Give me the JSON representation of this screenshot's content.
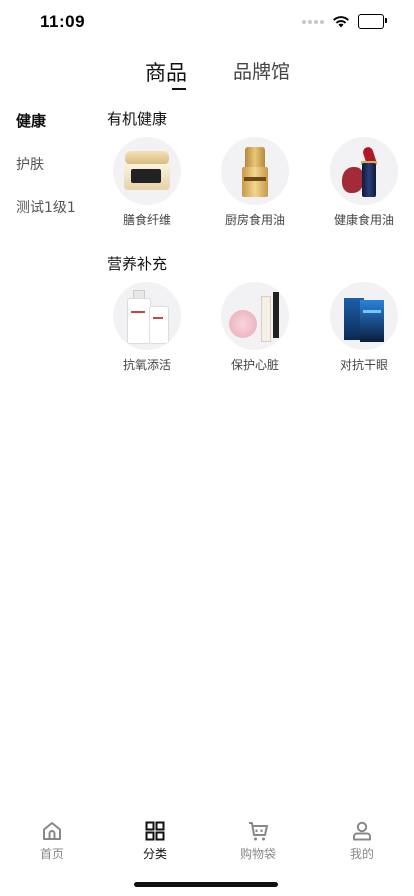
{
  "status_bar": {
    "time": "11:09"
  },
  "header": {
    "tabs": [
      {
        "label": "商品",
        "active": true
      },
      {
        "label": "品牌馆",
        "active": false
      }
    ]
  },
  "sidebar": {
    "items": [
      {
        "label": "健康",
        "active": true
      },
      {
        "label": "护肤",
        "active": false
      },
      {
        "label": "测试1级1",
        "active": false
      }
    ]
  },
  "sections": [
    {
      "title": "有机健康",
      "categories": [
        {
          "label": "膳食纤维",
          "icon": "cream-jar-icon"
        },
        {
          "label": "厨房食用油",
          "icon": "gold-bottle-icon"
        },
        {
          "label": "健康食用油",
          "icon": "lipstick-icon"
        }
      ]
    },
    {
      "title": "营养补充",
      "categories": [
        {
          "label": "抗氧添活",
          "icon": "pump-bottles-icon"
        },
        {
          "label": "保护心脏",
          "icon": "makeup-set-icon"
        },
        {
          "label": "对抗干眼",
          "icon": "blue-box-icon"
        }
      ]
    }
  ],
  "bottom_nav": {
    "items": [
      {
        "label": "首页",
        "icon": "home-icon",
        "active": false
      },
      {
        "label": "分类",
        "icon": "grid-icon",
        "active": true
      },
      {
        "label": "购物袋",
        "icon": "cart-icon",
        "active": false
      },
      {
        "label": "我的",
        "icon": "user-icon",
        "active": false
      }
    ]
  },
  "colors": {
    "accent": "#111111",
    "inactive": "#888888",
    "thumb_bg": "#f2f2f4"
  }
}
